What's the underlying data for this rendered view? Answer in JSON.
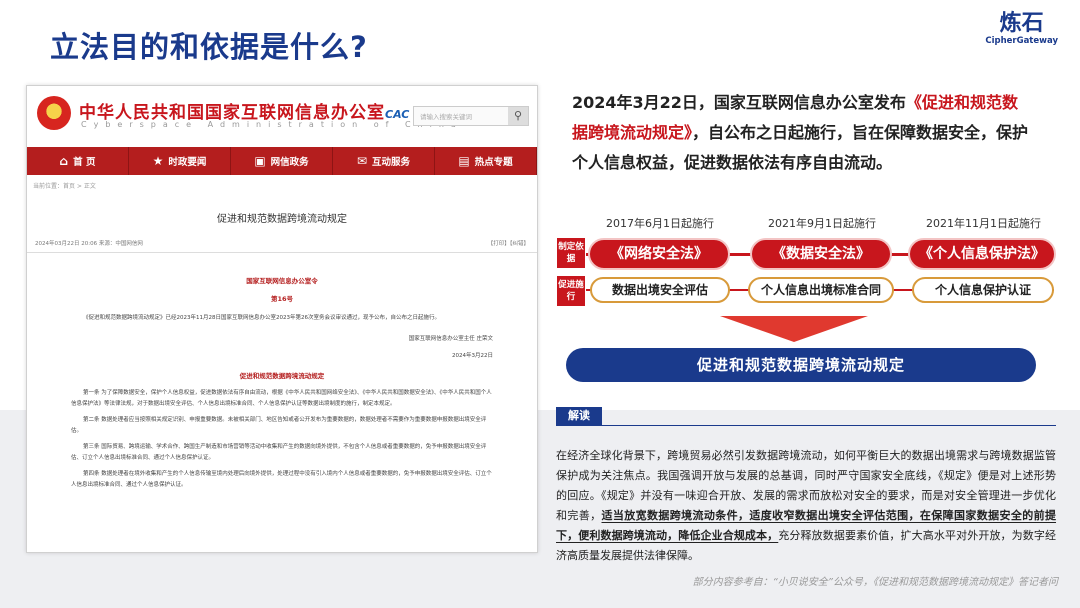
{
  "slide": {
    "title": "立法目的和依据是什么?",
    "logo_cn": "炼石",
    "logo_en": "CipherGateway"
  },
  "webpage": {
    "site_name": "中华人民共和国国家互联网信息办公室",
    "site_en": "Cyberspace Administration of China",
    "cac_label": "CAC",
    "search_placeholder": "请输入搜索关键词",
    "nav": [
      {
        "icon": "⌂",
        "label": "首 页"
      },
      {
        "icon": "★",
        "label": "时政要闻"
      },
      {
        "icon": "▣",
        "label": "网信政务"
      },
      {
        "icon": "✉",
        "label": "互动服务"
      },
      {
        "icon": "▤",
        "label": "热点专题"
      }
    ],
    "breadcrumb": "当前位置：首页 > 正文",
    "doc_title": "促进和规范数据跨境流动规定",
    "meta_date": "2024年03月22日 20:06   来源：中国网信网",
    "meta_actions": "【打印】【纠错】",
    "order_title": "国家互联网信息办公室令",
    "order_no": "第16号",
    "para1": "《促进和规范数据跨境流动规定》已经2023年11月28日国家互联网信息办公室2023年第26次室务会议审议通过，现予公布，自公布之日起施行。",
    "signature": "国家互联网信息办公室主任 庄荣文",
    "sign_date": "2024年3月22日",
    "rule_title": "促进和规范数据跨境流动规定",
    "art1": "第一条 为了保障数据安全，保护个人信息权益，促进数据依法有序自由流动，根据《中华人民共和国网络安全法》、《中华人民共和国数据安全法》、《中华人民共和国个人信息保护法》等法律法规，对于数据出境安全评估、个人信息出境标准合同、个人信息保护认证等数据出境制度的施行，制定本规定。",
    "art2": "第二条 数据处理者应当按照相关规定识别、申报重要数据。未被相关部门、地区告知或者公开发布为重要数据的，数据处理者不需要作为重要数据申报数据出境安全评估。",
    "art3": "第三条 国际贸易、跨境运输、学术合作、跨国生产制造和市场营销等活动中收集和产生的数据向境外提供，不包含个人信息或者重要数据的，免予申报数据出境安全评估、订立个人信息出境标准合同、通过个人信息保护认证。",
    "art4": "第四条 数据处理者在境外收集和产生的个人信息传输至境内处理后向境外提供，处理过程中没有引入境内个人信息或者重要数据的，免予申报数据出境安全评估、订立个人信息出境标准合同、通过个人信息保护认证。"
  },
  "intro": {
    "prefix": "2024年3月22日，国家互联网信息办公室发布",
    "highlight": "《促进和规范数据跨境流动规定》",
    "suffix": "，自公布之日起施行，旨在保障数据安全，保护个人信息权益，促进数据依法有序自由流动。"
  },
  "diagram": {
    "dates": [
      "2017年6月1日起施行",
      "2021年9月1日起施行",
      "2021年11月1日起施行"
    ],
    "row1_label": "制定依据",
    "row2_label": "促进施行",
    "laws": [
      "《网络安全法》",
      "《数据安全法》",
      "《个人信息保护法》"
    ],
    "mechanisms": [
      "数据出境安全评估",
      "个人信息出境标准合同",
      "个人信息保护认证"
    ],
    "result": "促进和规范数据跨境流动规定"
  },
  "interpretation": {
    "tab": "解读",
    "text1": "在经济全球化背景下，跨境贸易必然引发数据跨境流动，如何平衡巨大的数据出境需求与跨境数据监管保护成为关注焦点。我国强调开放与发展的总基调，同时严守国家安全底线，《规定》便是对上述形势的回应。《规定》并没有一味迎合开放、发展的需求而放松对安全的要求，而是对安全管理进一步优化和完善，",
    "bold": "适当放宽数据跨境流动条件，适度收窄数据出境安全评估范围，在保障国家数据安全的前提下，便利数据跨境流动，降低企业合规成本，",
    "text2": "充分释放数据要素价值，扩大高水平对外开放，为数字经济高质量发展提供法律保障。"
  },
  "source_note": "部分内容参考自：“小贝说安全”公众号，《促进和规范数据跨境流动规定》答记者问"
}
